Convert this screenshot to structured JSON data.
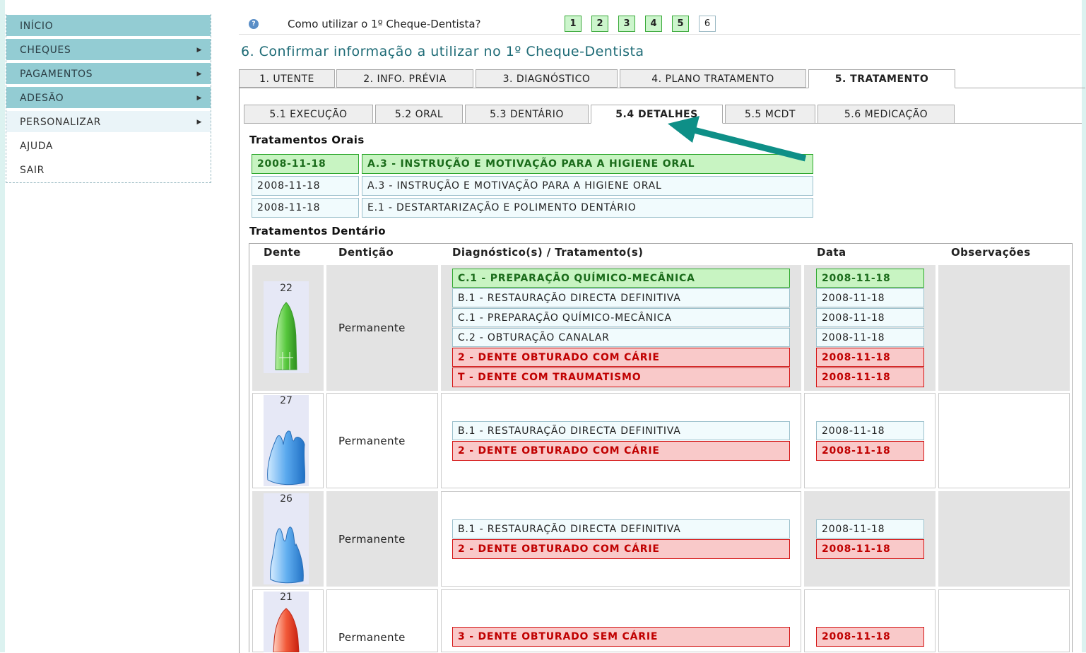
{
  "sidebar": {
    "items": [
      {
        "label": "INÍCIO",
        "arrow": ""
      },
      {
        "label": "CHEQUES",
        "arrow": "▶"
      },
      {
        "label": "PAGAMENTOS",
        "arrow": "▶"
      },
      {
        "label": "ADESÃO",
        "arrow": "▶"
      },
      {
        "label": "PERSONALIZAR",
        "arrow": "▶"
      },
      {
        "label": "AJUDA",
        "arrow": ""
      },
      {
        "label": "SAIR",
        "arrow": ""
      }
    ]
  },
  "help": {
    "icon_glyph": "?",
    "text": "Como utilizar o 1º Cheque-Dentista?",
    "steps": [
      "1",
      "2",
      "3",
      "4",
      "5",
      "6"
    ]
  },
  "page_title": "6. Confirmar informação a utilizar no 1º Cheque-Dentista",
  "main_tabs": [
    "1. UTENTE",
    "2. INFO. PRÉVIA",
    "3. DIAGNÓSTICO",
    "4. PLANO TRATAMENTO",
    "5. TRATAMENTO"
  ],
  "sub_tabs": [
    "5.1 EXECUÇÃO",
    "5.2 ORAL",
    "5.3 DENTÁRIO",
    "5.4 DETALHES",
    "5.5 MCDT",
    "5.6 MEDICAÇÃO"
  ],
  "oral": {
    "title": "Tratamentos Orais",
    "rows": [
      {
        "date": "2008-11-18",
        "treatment": "A.3 - INSTRUÇÃO E MOTIVAÇÃO PARA A HIGIENE ORAL"
      },
      {
        "date": "2008-11-18",
        "treatment": "A.3 - INSTRUÇÃO E MOTIVAÇÃO PARA A HIGIENE ORAL"
      },
      {
        "date": "2008-11-18",
        "treatment": "E.1 - DESTARTARIZAÇÃO E POLIMENTO DENTÁRIO"
      }
    ]
  },
  "dental": {
    "title": "Tratamentos Dentário",
    "headers": [
      "Dente",
      "Dentição",
      "Diagnóstico(s) / Tratamento(s)",
      "Data",
      "Observações"
    ],
    "teeth": [
      {
        "number": "22",
        "dentition": "Permanente",
        "items": [
          {
            "text": "C.1 - PREPARAÇÃO QUÍMICO-MECÂNICA",
            "date": "2008-11-18"
          },
          {
            "text": "B.1 - RESTAURAÇÃO DIRECTA DEFINITIVA",
            "date": "2008-11-18"
          },
          {
            "text": "C.1 - PREPARAÇÃO QUÍMICO-MECÂNICA",
            "date": "2008-11-18"
          },
          {
            "text": "C.2 - OBTURAÇÃO CANALAR",
            "date": "2008-11-18"
          },
          {
            "text": "2 - DENTE OBTURADO COM CÁRIE",
            "date": "2008-11-18"
          },
          {
            "text": "T - DENTE COM TRAUMATISMO",
            "date": "2008-11-18"
          }
        ]
      },
      {
        "number": "27",
        "dentition": "Permanente",
        "items": [
          {
            "text": "B.1 - RESTAURAÇÃO DIRECTA DEFINITIVA",
            "date": "2008-11-18"
          },
          {
            "text": "2 - DENTE OBTURADO COM CÁRIE",
            "date": "2008-11-18"
          }
        ]
      },
      {
        "number": "26",
        "dentition": "Permanente",
        "items": [
          {
            "text": "B.1 - RESTAURAÇÃO DIRECTA DEFINITIVA",
            "date": "2008-11-18"
          },
          {
            "text": "2 - DENTE OBTURADO COM CÁRIE",
            "date": "2008-11-18"
          }
        ]
      },
      {
        "number": "21",
        "dentition": "Permanente",
        "items": [
          {
            "text": "3 - DENTE OBTURADO SEM CÁRIE",
            "date": "2008-11-18"
          }
        ]
      }
    ]
  },
  "colors": {
    "menu_dark": "#93ccd3",
    "title_teal": "#1e6b76",
    "arrow_teal": "#0e8f87",
    "green_fill": "#c8f4c2",
    "red_fill": "#f9c9c9"
  }
}
